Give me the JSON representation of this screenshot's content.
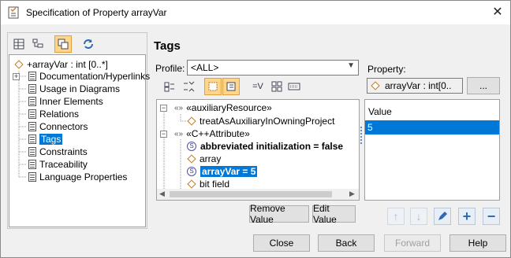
{
  "window": {
    "title": "Specification of Property arrayVar",
    "close_glyph": "✕"
  },
  "left_tree": {
    "root_label": "+arrayVar : int [0..*]",
    "items": [
      {
        "label": "Documentation/Hyperlinks",
        "expandable": true
      },
      {
        "label": "Usage in Diagrams"
      },
      {
        "label": "Inner Elements"
      },
      {
        "label": "Relations"
      },
      {
        "label": "Connectors"
      },
      {
        "label": "Tags",
        "selected": true
      },
      {
        "label": "Constraints"
      },
      {
        "label": "Traceability"
      },
      {
        "label": "Language Properties"
      }
    ]
  },
  "main": {
    "heading": "Tags",
    "profile_label": "Profile:",
    "profile_value": "<ALL>",
    "property_label": "Property:",
    "property_value": "arrayVar : int[0..",
    "property_more": "...",
    "tags_tree": [
      {
        "label": "«auxiliaryResource»",
        "stereo": "«»",
        "level": 0,
        "expanded": true
      },
      {
        "label": "treatAsAuxiliaryInOwningProject",
        "level": 1,
        "icon": "diamond"
      },
      {
        "label": "«C++Attribute»",
        "stereo": "«»",
        "level": 0,
        "expanded": true
      },
      {
        "label": "abbreviated initialization = false",
        "level": 1,
        "icon": "s",
        "bold": true
      },
      {
        "label": "array",
        "level": 1,
        "icon": "diamond"
      },
      {
        "label": "arrayVar = 5",
        "level": 1,
        "icon": "s",
        "bold": true,
        "selected": true
      },
      {
        "label": "bit field",
        "level": 1,
        "icon": "diamond"
      }
    ],
    "value_header": "Value",
    "value_rows": [
      "5"
    ],
    "remove_value": "Remove Value",
    "edit_value": "Edit Value"
  },
  "footer": {
    "close": "Close",
    "back": "Back",
    "forward": "Forward",
    "help": "Help"
  },
  "colors": {
    "selection": "#0078d7",
    "active_toggle": "#ffd58c"
  }
}
